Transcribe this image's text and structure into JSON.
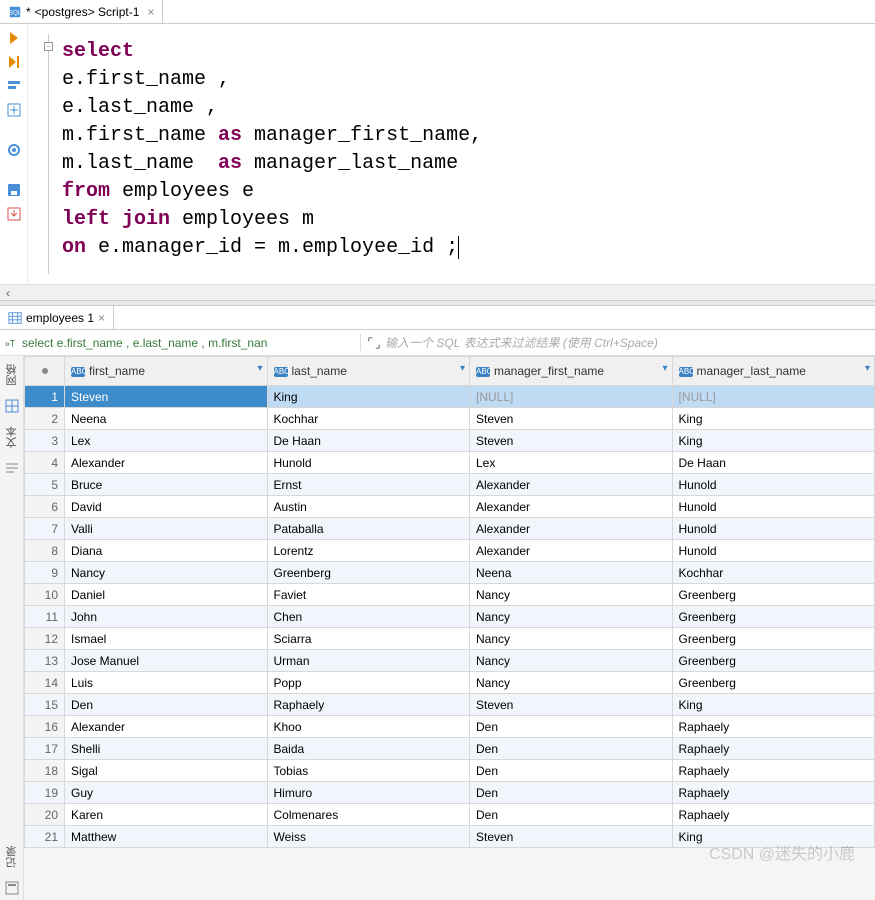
{
  "editor": {
    "tab_title": "<postgres> Script-1",
    "tab_dirty_marker": "*",
    "sql_tokens": [
      [
        {
          "t": "select",
          "c": "kw"
        }
      ],
      [
        {
          "t": "e.first_name ,",
          "c": ""
        }
      ],
      [
        {
          "t": "e.last_name ,",
          "c": ""
        }
      ],
      [
        {
          "t": "m.first_name ",
          "c": ""
        },
        {
          "t": "as",
          "c": "kw"
        },
        {
          "t": " manager_first_name,",
          "c": ""
        }
      ],
      [
        {
          "t": "m.last_name  ",
          "c": ""
        },
        {
          "t": "as",
          "c": "kw"
        },
        {
          "t": " manager_last_name",
          "c": ""
        }
      ],
      [
        {
          "t": "from",
          "c": "kw"
        },
        {
          "t": " employees e",
          "c": ""
        }
      ],
      [
        {
          "t": "left join",
          "c": "kw"
        },
        {
          "t": " employees m",
          "c": ""
        }
      ],
      [
        {
          "t": "on",
          "c": "kw"
        },
        {
          "t": " e.manager_id = m.employee_id ;",
          "c": ""
        }
      ]
    ]
  },
  "results": {
    "tab_title": "employees 1",
    "snippet": "select e.first_name , e.last_name , m.first_nan",
    "filter_placeholder": "输入一个 SQL 表达式来过滤结果 (使用 Ctrl+Space)",
    "columns": [
      "first_name",
      "last_name",
      "manager_first_name",
      "manager_last_name"
    ],
    "col_type_label": "ABC",
    "rows": [
      {
        "n": 1,
        "c": [
          "Steven",
          "King",
          "[NULL]",
          "[NULL]"
        ],
        "sel": true
      },
      {
        "n": 2,
        "c": [
          "Neena",
          "Kochhar",
          "Steven",
          "King"
        ]
      },
      {
        "n": 3,
        "c": [
          "Lex",
          "De Haan",
          "Steven",
          "King"
        ]
      },
      {
        "n": 4,
        "c": [
          "Alexander",
          "Hunold",
          "Lex",
          "De Haan"
        ]
      },
      {
        "n": 5,
        "c": [
          "Bruce",
          "Ernst",
          "Alexander",
          "Hunold"
        ]
      },
      {
        "n": 6,
        "c": [
          "David",
          "Austin",
          "Alexander",
          "Hunold"
        ]
      },
      {
        "n": 7,
        "c": [
          "Valli",
          "Pataballa",
          "Alexander",
          "Hunold"
        ]
      },
      {
        "n": 8,
        "c": [
          "Diana",
          "Lorentz",
          "Alexander",
          "Hunold"
        ]
      },
      {
        "n": 9,
        "c": [
          "Nancy",
          "Greenberg",
          "Neena",
          "Kochhar"
        ]
      },
      {
        "n": 10,
        "c": [
          "Daniel",
          "Faviet",
          "Nancy",
          "Greenberg"
        ]
      },
      {
        "n": 11,
        "c": [
          "John",
          "Chen",
          "Nancy",
          "Greenberg"
        ]
      },
      {
        "n": 12,
        "c": [
          "Ismael",
          "Sciarra",
          "Nancy",
          "Greenberg"
        ]
      },
      {
        "n": 13,
        "c": [
          "Jose Manuel",
          "Urman",
          "Nancy",
          "Greenberg"
        ]
      },
      {
        "n": 14,
        "c": [
          "Luis",
          "Popp",
          "Nancy",
          "Greenberg"
        ]
      },
      {
        "n": 15,
        "c": [
          "Den",
          "Raphaely",
          "Steven",
          "King"
        ]
      },
      {
        "n": 16,
        "c": [
          "Alexander",
          "Khoo",
          "Den",
          "Raphaely"
        ]
      },
      {
        "n": 17,
        "c": [
          "Shelli",
          "Baida",
          "Den",
          "Raphaely"
        ]
      },
      {
        "n": 18,
        "c": [
          "Sigal",
          "Tobias",
          "Den",
          "Raphaely"
        ]
      },
      {
        "n": 19,
        "c": [
          "Guy",
          "Himuro",
          "Den",
          "Raphaely"
        ]
      },
      {
        "n": 20,
        "c": [
          "Karen",
          "Colmenares",
          "Den",
          "Raphaely"
        ]
      },
      {
        "n": 21,
        "c": [
          "Matthew",
          "Weiss",
          "Steven",
          "King"
        ]
      }
    ]
  },
  "side_tabs": {
    "grid": "网格",
    "text": "文本",
    "record": "记录"
  },
  "watermark": "CSDN @迷失的小鹿"
}
